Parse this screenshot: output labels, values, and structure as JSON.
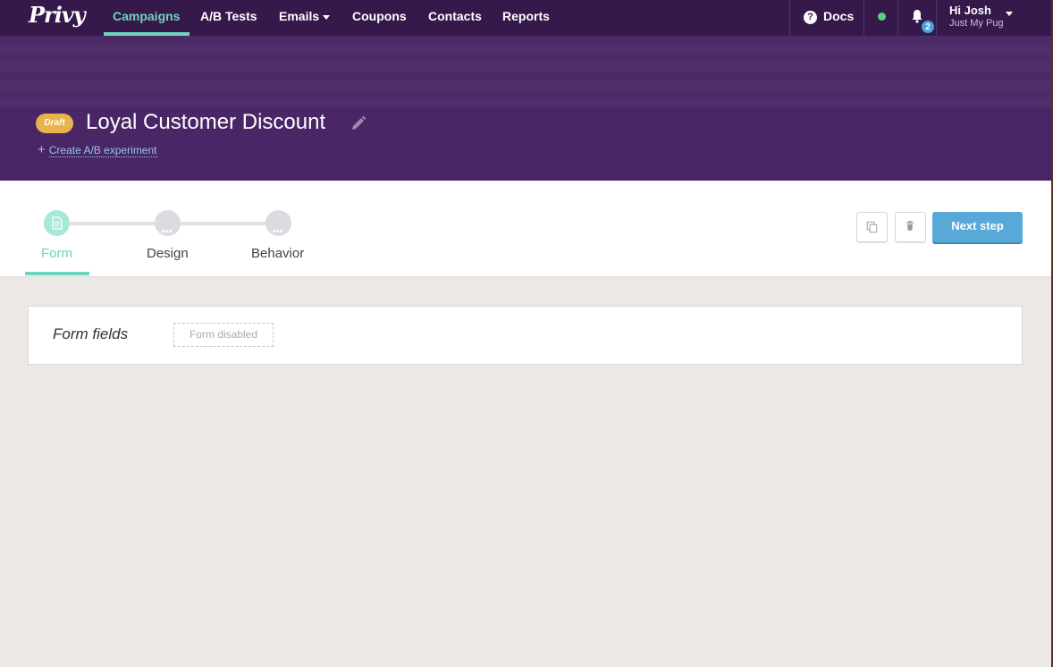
{
  "nav": {
    "logo": "Privy",
    "links": [
      "Campaigns",
      "A/B Tests",
      "Emails",
      "Coupons",
      "Contacts",
      "Reports"
    ],
    "docs_label": "Docs",
    "notification_count": "2",
    "user_greeting": "Hi Josh",
    "user_account": "Just My Pug",
    "accent_color": "#6fd4bd"
  },
  "campaign": {
    "status_badge": "Draft",
    "title": "Loyal Customer Discount",
    "create_ab_label": "Create A/B experiment"
  },
  "stepper": {
    "steps": [
      "Form",
      "Design",
      "Behavior"
    ],
    "active_step": "Form",
    "next_button": "Next step"
  },
  "panel": {
    "title": "Form fields",
    "form_state": "Form disabled"
  }
}
